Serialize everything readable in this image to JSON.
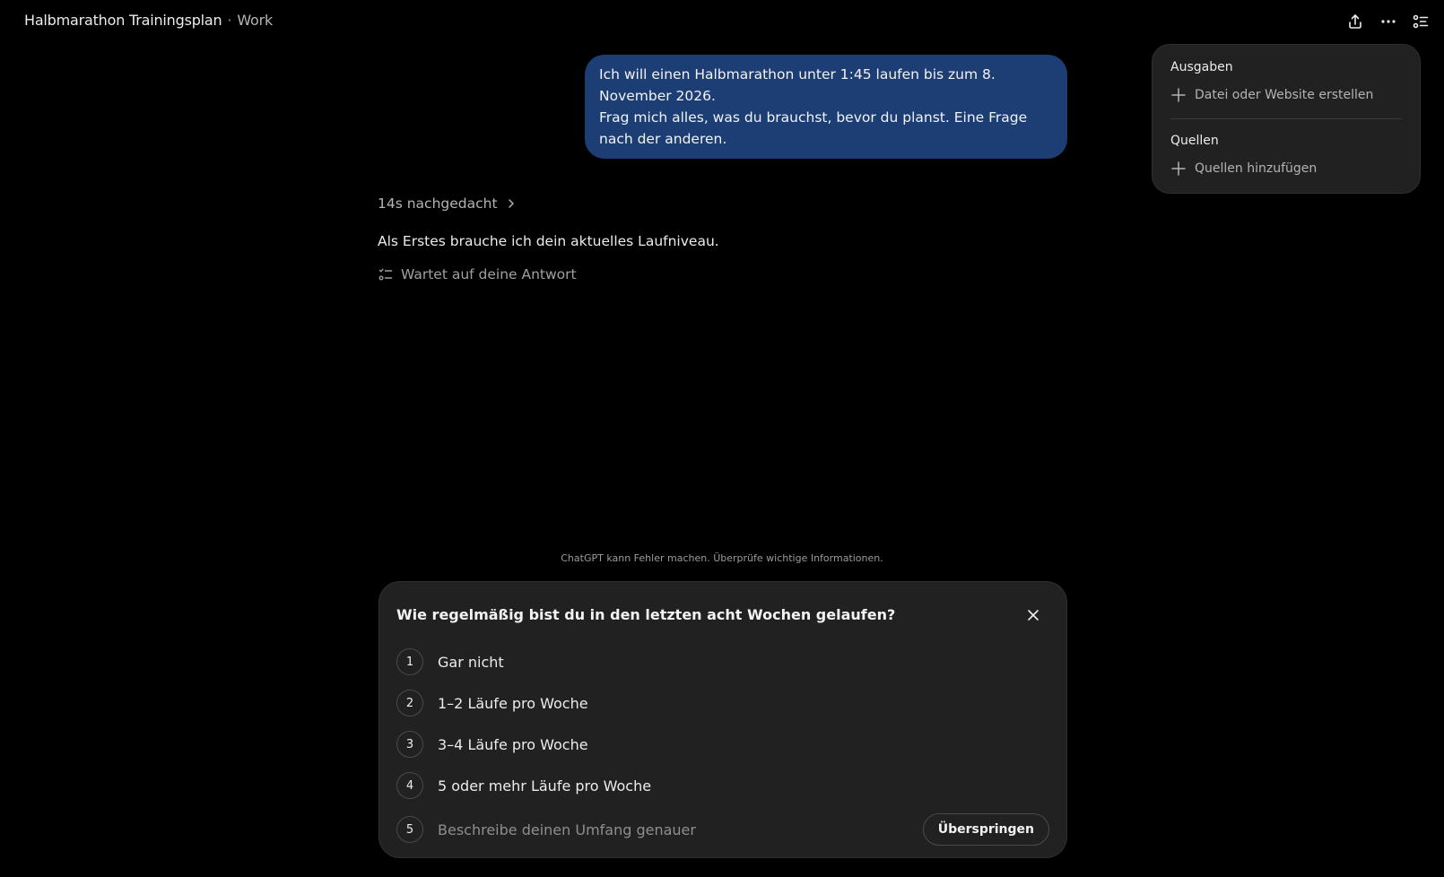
{
  "header": {
    "title": "Halbmarathon Trainingsplan",
    "separator": "·",
    "project": "Work",
    "icons": [
      "share-icon",
      "more-icon",
      "panel-list-icon"
    ]
  },
  "side_panel": {
    "outputs_heading": "Ausgaben",
    "create_label": "Datei oder Website erstellen",
    "sources_heading": "Quellen",
    "add_sources_label": "Quellen hinzufügen"
  },
  "conversation": {
    "user_message_line1": "Ich will einen Halbmarathon unter 1:45 laufen bis zum 8. November 2026.",
    "user_message_line2": "Frag mich alles, was du brauchst, bevor du planst. Eine Frage nach der anderen.",
    "thought_label": "14s nachgedacht",
    "assistant_answer": "Als Erstes brauche ich dein aktuelles Laufniveau.",
    "waiting_label": "Wartet auf deine Antwort"
  },
  "disclaimer": "ChatGPT kann Fehler machen. Überprüfe wichtige Informationen.",
  "question_card": {
    "question": "Wie regelmäßig bist du in den letzten acht Wochen gelaufen?",
    "options": [
      {
        "number": "1",
        "label": "Gar nicht"
      },
      {
        "number": "2",
        "label": "1–2 Läufe pro Woche"
      },
      {
        "number": "3",
        "label": "3–4 Läufe pro Woche"
      },
      {
        "number": "4",
        "label": "5 oder mehr Läufe pro Woche"
      }
    ],
    "custom_number": "5",
    "custom_placeholder": "Beschreibe deinen Umfang genauer",
    "skip_label": "Überspringen"
  },
  "colors": {
    "background": "#000000",
    "user_bubble": "#1c3e74",
    "card": "#212121"
  }
}
